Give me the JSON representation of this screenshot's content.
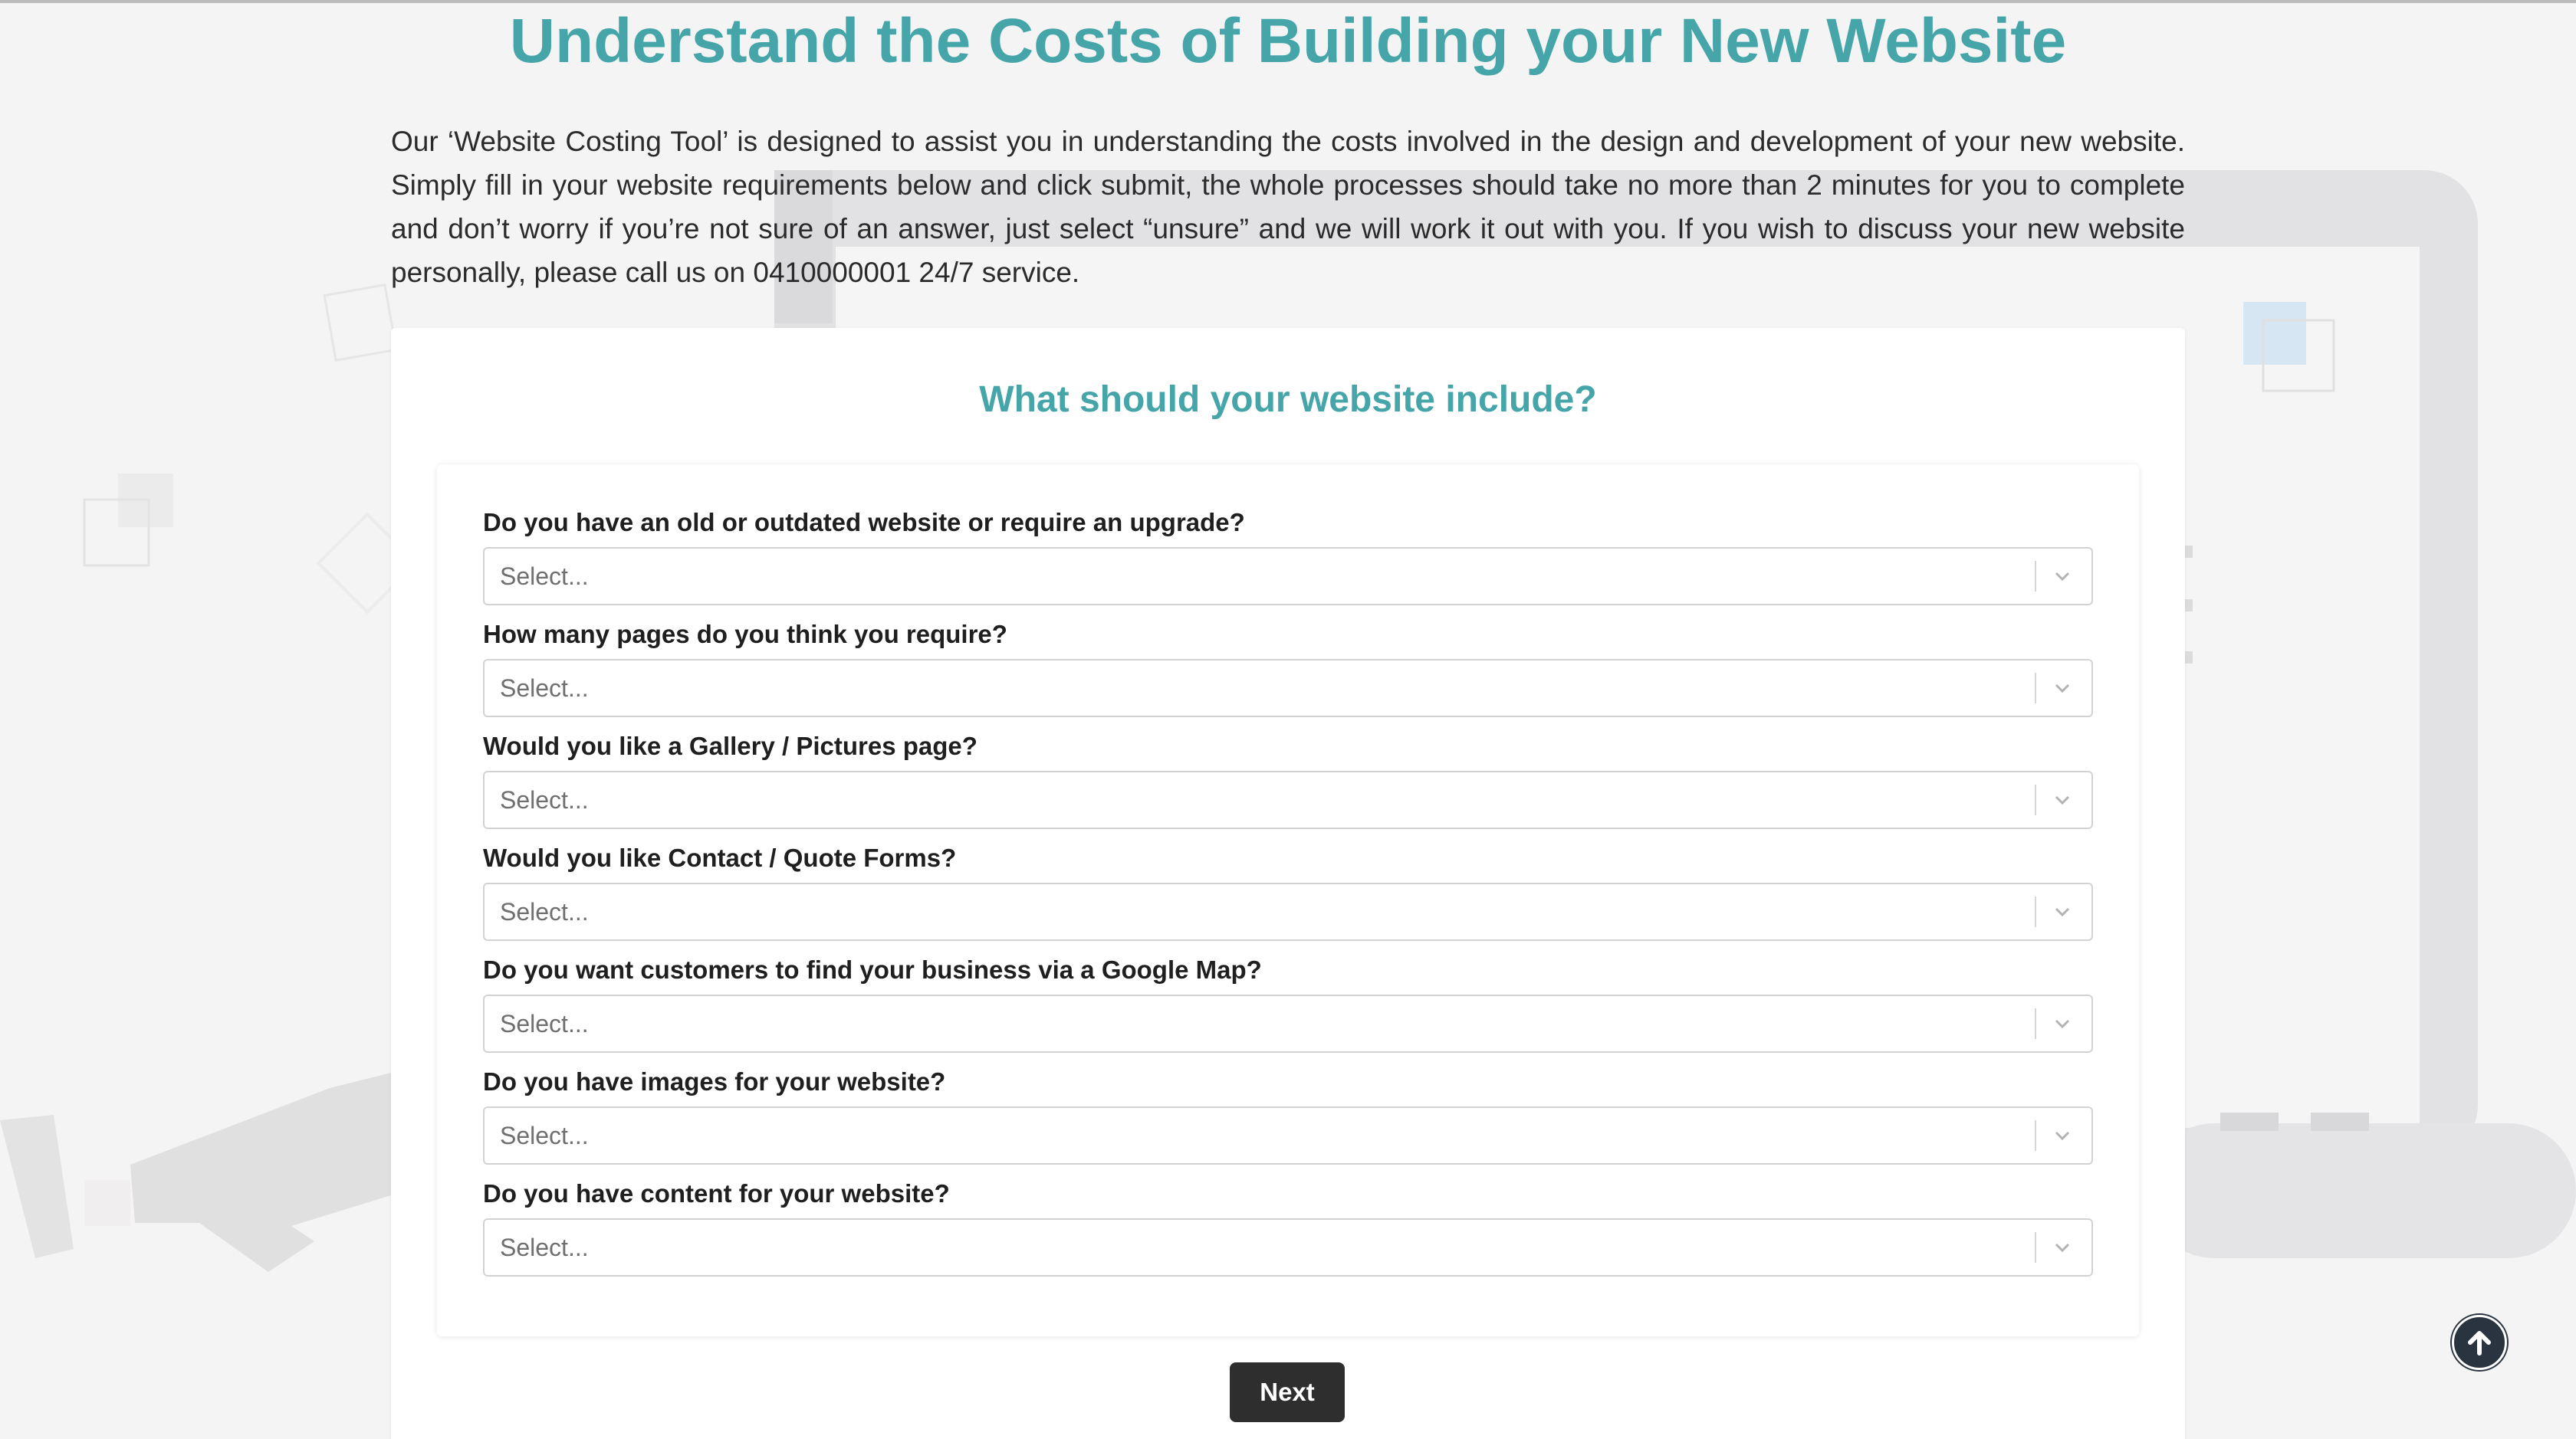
{
  "page": {
    "title": "Understand the Costs of Building your New Website",
    "intro": "Our ‘Website Costing Tool’ is designed to assist you in understanding the costs involved in the design and development of your new website. Simply fill in your website requirements below and click submit, the whole processes should take no more than 2 minutes for you to complete and don’t worry if you’re not sure of an answer, just select “unsure” and we will work it out with you. If you wish to discuss your new website personally, please call us on 0410000001 24/7 service."
  },
  "form": {
    "heading": "What should your website include?",
    "fields": [
      {
        "label": "Do you have an old or outdated website or require an upgrade?",
        "value": "Select..."
      },
      {
        "label": "How many pages do you think you require?",
        "value": "Select..."
      },
      {
        "label": "Would you like a Gallery / Pictures page?",
        "value": "Select..."
      },
      {
        "label": "Would you like Contact / Quote Forms?",
        "value": "Select..."
      },
      {
        "label": "Do you want customers to find your business via a Google Map?",
        "value": "Select..."
      },
      {
        "label": "Do you have images for your website?",
        "value": "Select..."
      },
      {
        "label": "Do you have content for your website?",
        "value": "Select..."
      }
    ],
    "next_label": "Next"
  },
  "icons": {
    "select_arrow": "chevron-down-icon",
    "scroll_top": "arrow-up-circle-icon"
  },
  "colors": {
    "accent": "#45a5a9",
    "button": "#2e2e2e",
    "text": "#2b2b2b",
    "background": "#f4f4f4"
  }
}
